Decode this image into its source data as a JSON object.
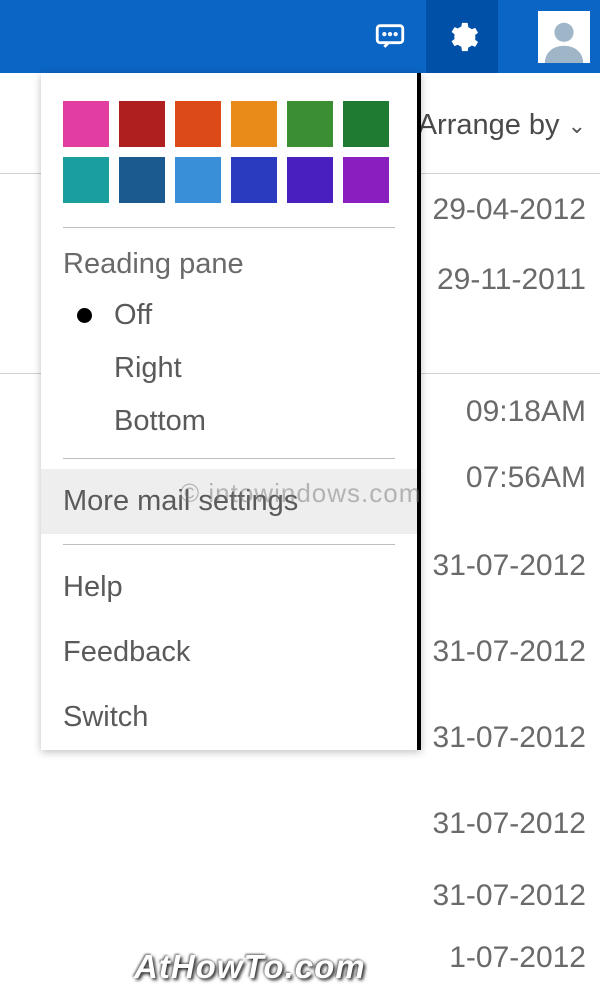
{
  "topbar": {
    "chat_icon": "chat",
    "settings_icon": "gear",
    "avatar_icon": "avatar"
  },
  "arrange": {
    "label": "Arrange by"
  },
  "messages": {
    "dates": [
      "29-04-2012",
      "29-11-2011",
      "09:18AM",
      "07:56AM",
      "31-07-2012",
      "31-07-2012",
      "31-07-2012",
      "31-07-2012",
      "31-07-2012",
      "1-07-2012"
    ]
  },
  "dropdown": {
    "colors_row1": [
      "#e23ea2",
      "#b01f1f",
      "#dc4a18",
      "#e88b18",
      "#3b8f32",
      "#1f7a32"
    ],
    "colors_row2": [
      "#1a9e9e",
      "#1a5a8f",
      "#3a8fd9",
      "#2a3bbf",
      "#4a1fbf",
      "#8a1fbf"
    ],
    "reading_pane_label": "Reading pane",
    "reading_options": {
      "off": "Off",
      "right": "Right",
      "bottom": "Bottom"
    },
    "selected_reading": "off",
    "more_mail": "More mail settings",
    "help": "Help",
    "feedback": "Feedback",
    "switch": "Switch"
  },
  "watermarks": {
    "w1": "© intowindows.com",
    "w2": "AtHowTo.com"
  }
}
